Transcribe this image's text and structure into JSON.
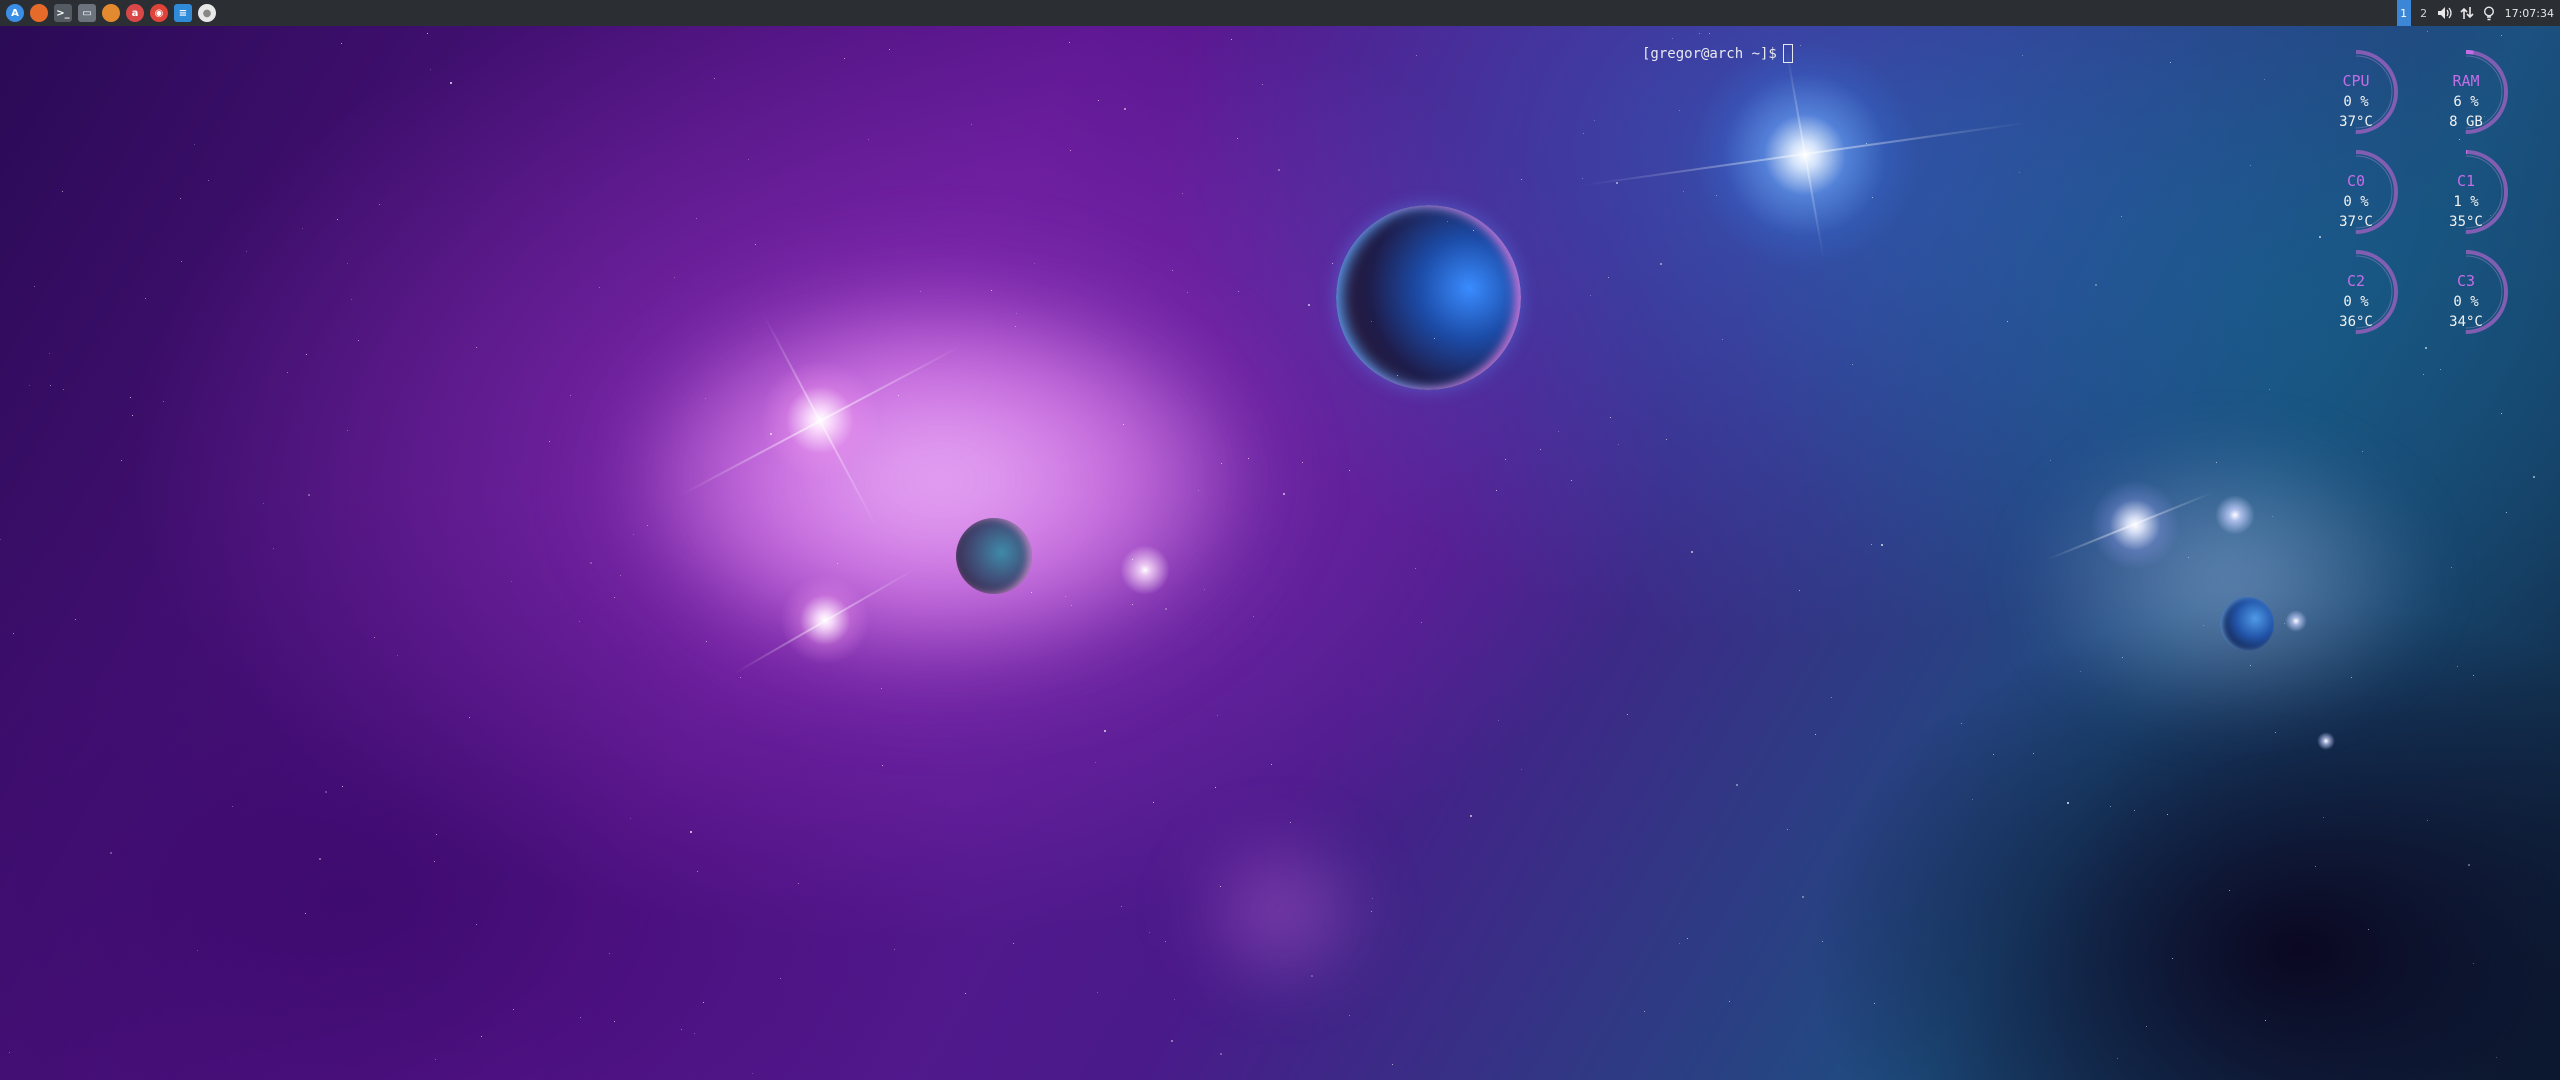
{
  "taskbar": {
    "launchers": [
      {
        "name": "app-menu-icon",
        "glyph": "A",
        "color": "#3a8ee6",
        "square": false
      },
      {
        "name": "firefox-icon",
        "glyph": "",
        "color": "#e66b2b",
        "square": false
      },
      {
        "name": "terminal-icon",
        "glyph": ">_",
        "color": "#555b63",
        "square": true
      },
      {
        "name": "file-manager-icon",
        "glyph": "▭",
        "color": "#6c737c",
        "square": true
      },
      {
        "name": "gimp-icon",
        "glyph": "",
        "color": "#e3892f",
        "square": false
      },
      {
        "name": "app-icon-red",
        "glyph": "a",
        "color": "#d94848",
        "square": false
      },
      {
        "name": "media-player-icon",
        "glyph": "◉",
        "color": "#e04338",
        "square": false
      },
      {
        "name": "text-editor-icon",
        "glyph": "≡",
        "color": "#2f8ad8",
        "square": true
      },
      {
        "name": "settings-icon",
        "glyph": "●",
        "color": "#e8e8e8",
        "square": false
      }
    ],
    "workspaces": [
      "1",
      "2"
    ],
    "active_workspace": "1",
    "clock": "17:07:34"
  },
  "terminal": {
    "prompt": "[gregor@arch ~]$"
  },
  "conky": [
    {
      "id": "cpu",
      "label": "CPU",
      "value": "0 %",
      "sub": "37°C",
      "level": 0.0
    },
    {
      "id": "ram",
      "label": "RAM",
      "value": "6 %",
      "sub": "8 GB",
      "level": 0.06
    },
    {
      "id": "c0",
      "label": "C0",
      "value": "0 %",
      "sub": "37°C",
      "level": 0.0
    },
    {
      "id": "c1",
      "label": "C1",
      "value": "1 %",
      "sub": "35°C",
      "level": 0.01
    },
    {
      "id": "c2",
      "label": "C2",
      "value": "0 %",
      "sub": "36°C",
      "level": 0.0
    },
    {
      "id": "c3",
      "label": "C3",
      "value": "0 %",
      "sub": "34°C",
      "level": 0.0
    }
  ],
  "colors": {
    "accent": "#c36ee6",
    "ring": "#8e5fb8",
    "panel": "#2b2e33",
    "workspace_active": "#3b86d6"
  }
}
